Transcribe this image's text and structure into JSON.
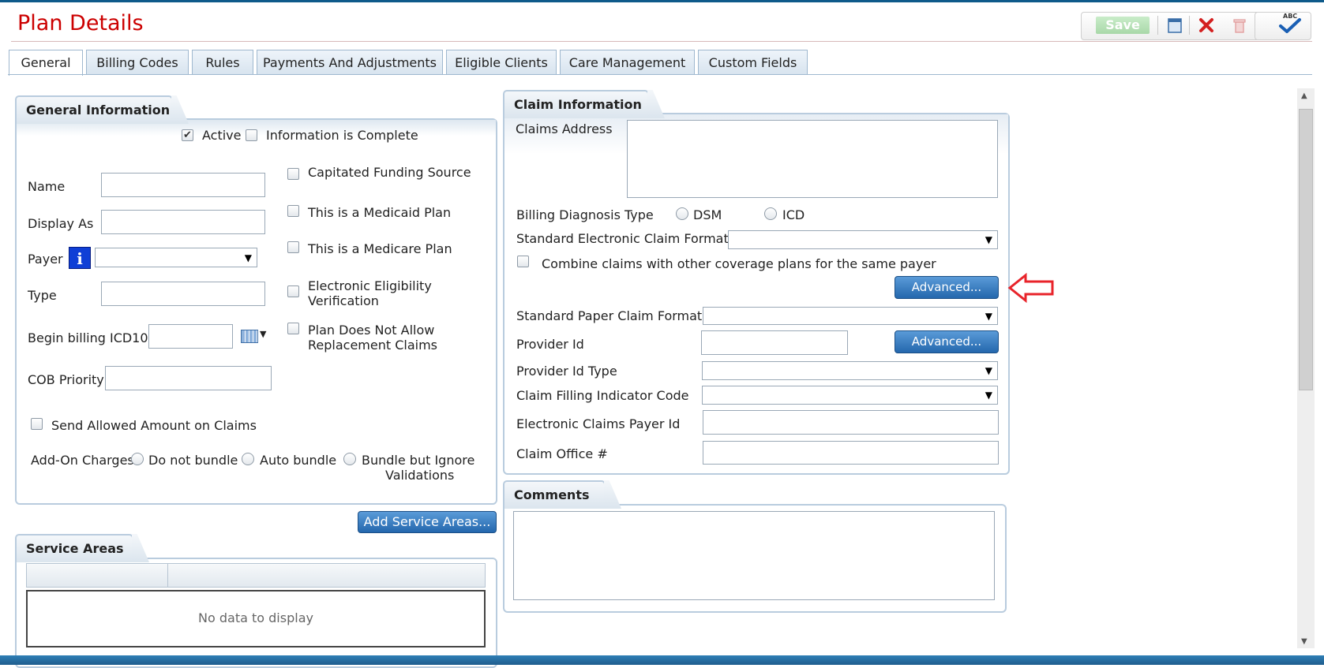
{
  "header": {
    "title": "Plan Details"
  },
  "toolbar": {
    "save_label": "Save",
    "spell_label": "ABC"
  },
  "tabs": [
    {
      "label": "General"
    },
    {
      "label": "Billing Codes"
    },
    {
      "label": "Rules"
    },
    {
      "label": "Payments And Adjustments"
    },
    {
      "label": "Eligible Clients"
    },
    {
      "label": "Care Management"
    },
    {
      "label": "Custom Fields"
    }
  ],
  "general": {
    "title": "General Information",
    "active_label": "Active",
    "active_checked": true,
    "complete_label": "Information is Complete",
    "name_label": "Name",
    "display_as_label": "Display As",
    "payer_label": "Payer",
    "type_label": "Type",
    "begin_billing_label": "Begin billing ICD10",
    "cob_priority_label": "COB Priority",
    "capitated_label": "Capitated Funding Source",
    "medicaid_label": "This is a Medicaid Plan",
    "medicare_label": "This is a Medicare Plan",
    "eev_label_1": "Electronic Eligibility",
    "eev_label_2": "Verification",
    "replacement_label_1": "Plan Does Not Allow",
    "replacement_label_2": "Replacement Claims",
    "send_allowed_label": "Send Allowed Amount on Claims",
    "addon_label": "Add-On Charges",
    "do_not_bundle_label": "Do not bundle",
    "auto_bundle_label": "Auto bundle",
    "bundle_ignore_label_1": "Bundle but Ignore",
    "bundle_ignore_label_2": "Validations"
  },
  "service_areas": {
    "add_button": "Add Service Areas...",
    "title": "Service Areas",
    "empty_text": "No data to display"
  },
  "claim": {
    "title": "Claim Information",
    "claims_address_label": "Claims Address",
    "billing_diag_label": "Billing Diagnosis Type",
    "dsm_label": "DSM",
    "icd_label": "ICD",
    "std_elec_label": "Standard Electronic Claim Format",
    "combine_label": "Combine claims with other coverage plans for the same payer",
    "advanced_label": "Advanced...",
    "std_paper_label": "Standard Paper Claim Format",
    "provider_id_label": "Provider Id",
    "provider_id_type_label": "Provider Id Type",
    "claim_filing_label": "Claim Filling Indicator Code",
    "elec_payer_label": "Electronic Claims Payer Id",
    "claim_office_label": "Claim Office #"
  },
  "comments": {
    "title": "Comments"
  },
  "colors": {
    "title_red": "#cc0000",
    "button_blue": "#2467ad",
    "panel_border": "#b9ccde",
    "info_blue": "#0f3fd6",
    "arrow_red": "#e8232a"
  }
}
